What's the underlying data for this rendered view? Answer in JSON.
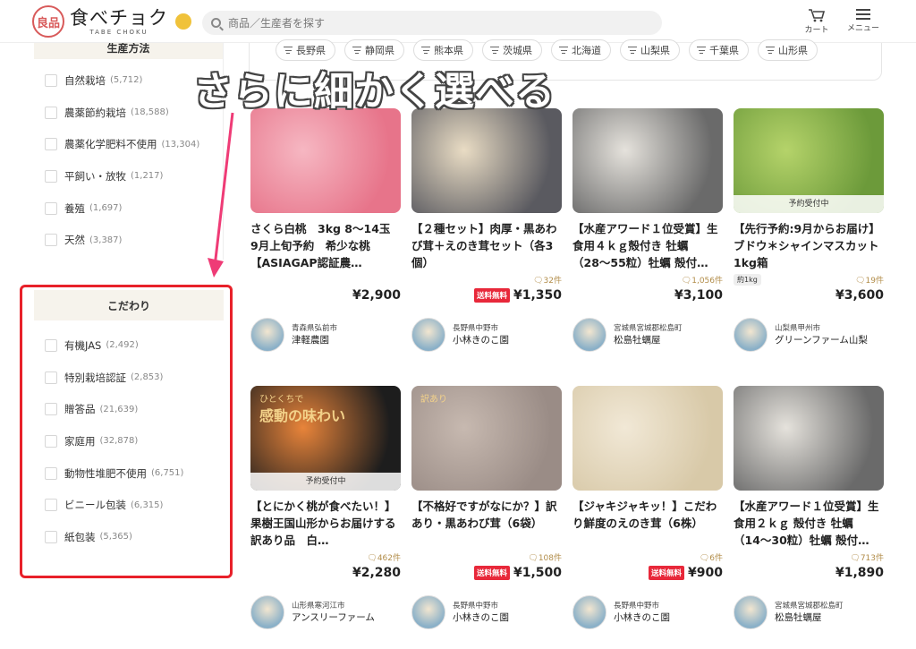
{
  "header": {
    "logo_seal": "良品",
    "logo_main": "食べチョク",
    "logo_sub": "TABE CHOKU",
    "search_placeholder": "商品／生産者を探す",
    "cart_label": "カート",
    "menu_label": "メニュー"
  },
  "prefectures": [
    "長野県",
    "静岡県",
    "熊本県",
    "茨城県",
    "北海道",
    "山梨県",
    "千葉県",
    "山形県"
  ],
  "overlay_text": "さらに細かく選べる",
  "sidebar": {
    "production_method": {
      "title": "生産方法",
      "items": [
        {
          "label": "自然栽培",
          "count": "(5,712)"
        },
        {
          "label": "農薬節約栽培",
          "count": "(18,588)"
        },
        {
          "label": "農薬化学肥料不使用",
          "count": "(13,304)"
        },
        {
          "label": "平飼い・放牧",
          "count": "(1,217)"
        },
        {
          "label": "養殖",
          "count": "(1,697)"
        },
        {
          "label": "天然",
          "count": "(3,387)"
        }
      ]
    },
    "kodawari": {
      "title": "こだわり",
      "items": [
        {
          "label": "有機JAS",
          "count": "(2,492)"
        },
        {
          "label": "特別栽培認証",
          "count": "(2,853)"
        },
        {
          "label": "贈答品",
          "count": "(21,639)"
        },
        {
          "label": "家庭用",
          "count": "(32,878)"
        },
        {
          "label": "動物性堆肥不使用",
          "count": "(6,751)"
        },
        {
          "label": "ビニール包装",
          "count": "(6,315)"
        },
        {
          "label": "紙包装",
          "count": "(5,365)"
        }
      ]
    }
  },
  "products": [
    {
      "title": "さくら白桃　3kg 8〜14玉　9月上旬予約　希少な桃　【ASIAGAP認証農…",
      "reviews": "",
      "free_ship": "",
      "weight": "",
      "price": "¥2,900",
      "location": "青森県弘前市",
      "producer": "津軽農園",
      "reserve": "",
      "img_color": "#e7748a",
      "img_color2": "#f6b7c2"
    },
    {
      "title": "【２種セット】肉厚・黒あわび茸＋えのき茸セット（各3個）",
      "reviews": "32件",
      "free_ship": "送料無料",
      "weight": "",
      "price": "¥1,350",
      "location": "長野県中野市",
      "producer": "小林きのこ園",
      "reserve": "",
      "img_color": "#5a5a60",
      "img_color2": "#e9dcc4"
    },
    {
      "title": "【水産アワード１位受賞】生食用４ｋｇ殻付き 牡蠣（28〜55粒）牡蠣 殻付…",
      "reviews": "1,056件",
      "free_ship": "",
      "weight": "",
      "price": "¥3,100",
      "location": "宮城県宮城郡松島町",
      "producer": "松島牡蠣屋",
      "reserve": "",
      "img_color": "#6a6a6a",
      "img_color2": "#e5e2dc"
    },
    {
      "title": "【先行予約:9月からお届け】ブドウ＊シャインマスカット 1kg箱",
      "reviews": "19件",
      "free_ship": "",
      "weight": "約1kg",
      "price": "¥3,600",
      "location": "山梨県甲州市",
      "producer": "グリーンファーム山梨",
      "reserve": "予約受付中",
      "img_color": "#6c9a3a",
      "img_color2": "#b5d36a"
    },
    {
      "title": "【とにかく桃が食べたい！】果樹王国山形からお届けする　訳あり品　白…",
      "reviews": "462件",
      "free_ship": "",
      "weight": "",
      "price": "¥2,280",
      "location": "山形県寒河江市",
      "producer": "アンスリーファーム",
      "reserve": "予約受付中",
      "img_color": "#1d1d1d",
      "img_color2": "#e8843a",
      "img_text1": "ひとくちで",
      "img_text2": "感動の味わい"
    },
    {
      "title": "【不格好ですがなにか？】訳あり・黒あわび茸（6袋）",
      "reviews": "108件",
      "free_ship": "送料無料",
      "weight": "",
      "price": "¥1,500",
      "location": "長野県中野市",
      "producer": "小林きのこ園",
      "reserve": "",
      "img_color": "#9a8c86",
      "img_color2": "#c7b9b0",
      "img_text1": "訳あり",
      "img_text2": ""
    },
    {
      "title": "【ジャキジャキッ！】こだわり鮮度のえのき茸（6株）",
      "reviews": "6件",
      "free_ship": "送料無料",
      "weight": "",
      "price": "¥900",
      "location": "長野県中野市",
      "producer": "小林きのこ園",
      "reserve": "",
      "img_color": "#d8c9a8",
      "img_color2": "#f1e8d6"
    },
    {
      "title": "【水産アワード１位受賞】生食用２ｋｇ 殻付き 牡蠣（14〜30粒）牡蠣 殻付…",
      "reviews": "713件",
      "free_ship": "",
      "weight": "",
      "price": "¥1,890",
      "location": "宮城県宮城郡松島町",
      "producer": "松島牡蠣屋",
      "reserve": "",
      "img_color": "#6a6a6a",
      "img_color2": "#e5e2dc"
    }
  ]
}
